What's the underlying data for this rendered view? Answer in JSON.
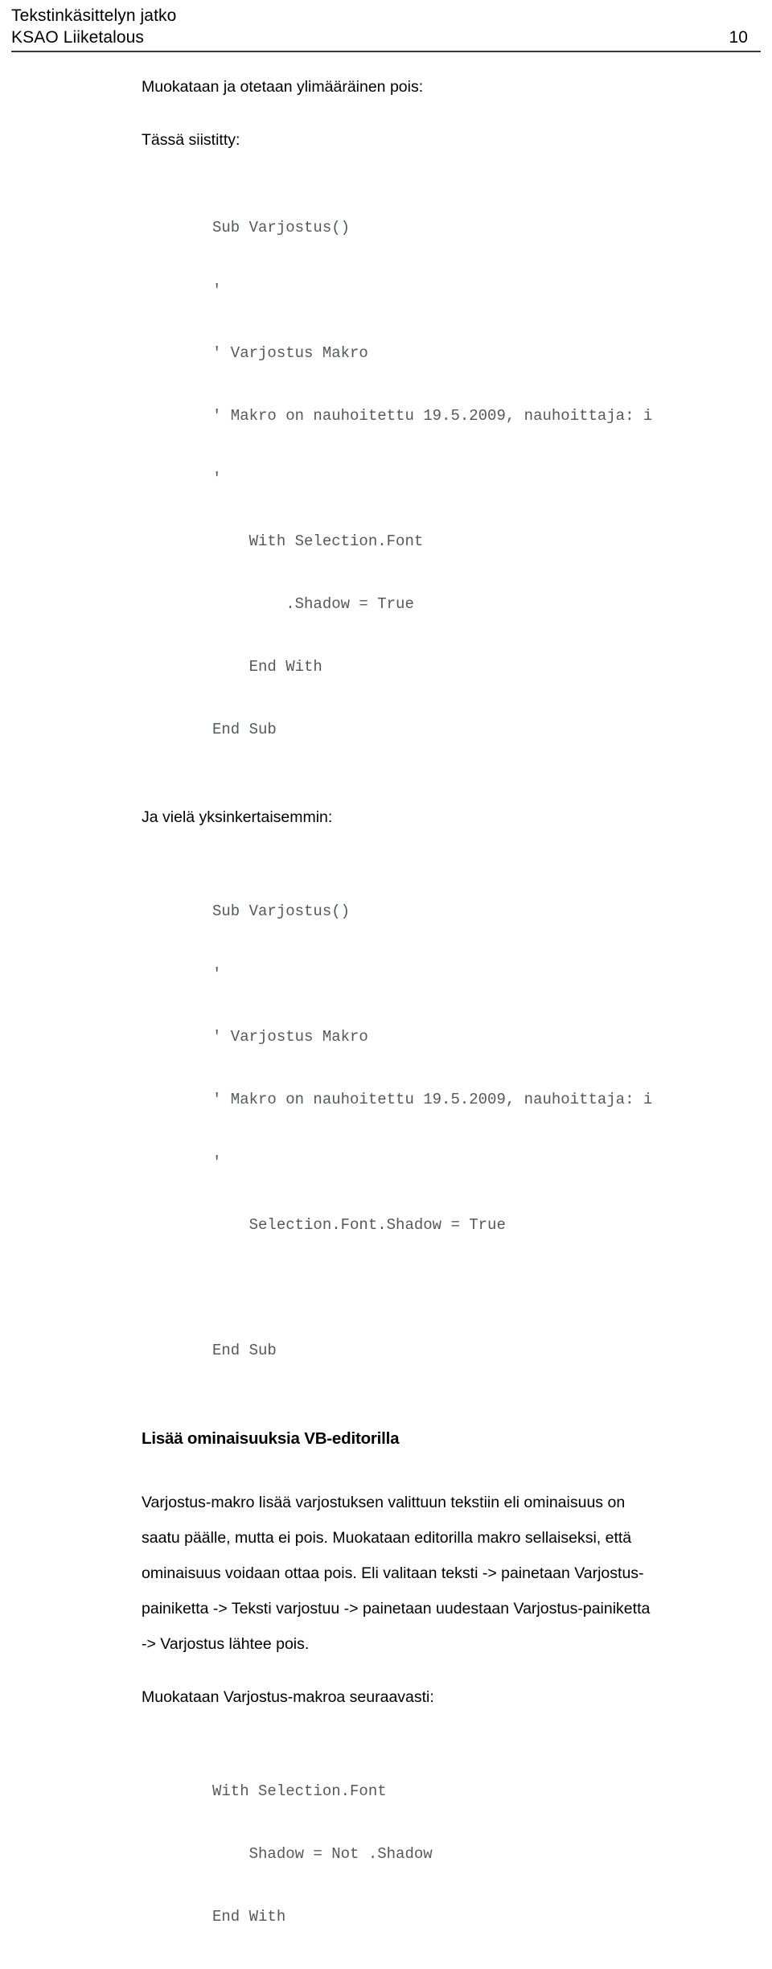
{
  "header": {
    "title_line_1": "Tekstinkäsittelyn jatko",
    "title_line_2": "KSAO Liiketalous",
    "page_number": "10"
  },
  "body": {
    "intro_paragraph": "Muokataan ja otetaan ylimääräinen pois:",
    "label_tassa_siistitty": "Tässä siistitty:",
    "label_ja_viela": "Ja vielä yksinkertaisemmin:",
    "heading_lisaa_ominaisuuksia": "Lisää ominaisuuksia VB-editorilla",
    "paragraph_line_1": "Varjostus-makro lisää varjostuksen valittuun tekstiin eli ominaisuus on",
    "paragraph_line_2": "saatu päälle, mutta ei pois. Muokataan editorilla makro sellaiseksi, että",
    "paragraph_line_3": "ominaisuus voidaan ottaa pois. Eli valitaan teksti -> painetaan Varjostus-",
    "paragraph_line_4": "painiketta -> Teksti varjostuu -> painetaan uudestaan Varjostus-painiketta",
    "paragraph_line_5": " -> Varjostus lähtee pois.",
    "label_muokataan_makroa": "Muokataan Varjostus-makroa seuraavasti:"
  },
  "code_blocks": {
    "block_1": [
      "Sub Varjostus()",
      "'",
      "' Varjostus Makro",
      "' Makro on nauhoitettu 19.5.2009, nauhoittaja: i",
      "'",
      "    With Selection.Font",
      "        .Shadow = True",
      "    End With",
      "End Sub"
    ],
    "block_2": [
      "Sub Varjostus()",
      "'",
      "' Varjostus Makro",
      "' Makro on nauhoitettu 19.5.2009, nauhoittaja: i",
      "'",
      "    Selection.Font.Shadow = True",
      "",
      "End Sub"
    ],
    "block_3": [
      "With Selection.Font",
      "    Shadow = Not .Shadow",
      "End With"
    ]
  },
  "colors": {
    "text": "#000000",
    "code_text": "#55585a",
    "rule": "#3a3a3a",
    "background": "#ffffff"
  }
}
